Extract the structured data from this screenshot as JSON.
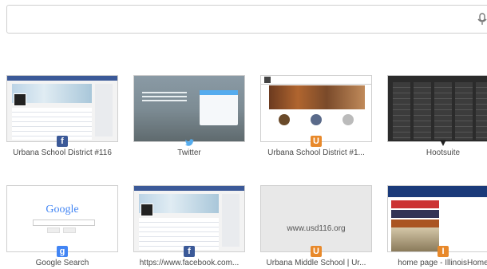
{
  "search": {
    "placeholder": ""
  },
  "tiles": [
    {
      "title": "Urbana School District #116"
    },
    {
      "title": "Twitter"
    },
    {
      "title": "Urbana School District #1..."
    },
    {
      "title": "Hootsuite"
    },
    {
      "title": "Google Search"
    },
    {
      "title": "https://www.facebook.com..."
    },
    {
      "title": "Urbana Middle School | Ur..."
    },
    {
      "title": "home page - IllinoisHome"
    }
  ],
  "thumb_text": {
    "google_logo": "Google",
    "usd_url": "www.usd116.org"
  },
  "icons": {
    "facebook": "f",
    "google": "g",
    "urbana": "U"
  },
  "colors": {
    "facebook": "#3b5998",
    "twitter": "#55acee",
    "urbana": "#e8892b",
    "google": "#4285f4"
  }
}
